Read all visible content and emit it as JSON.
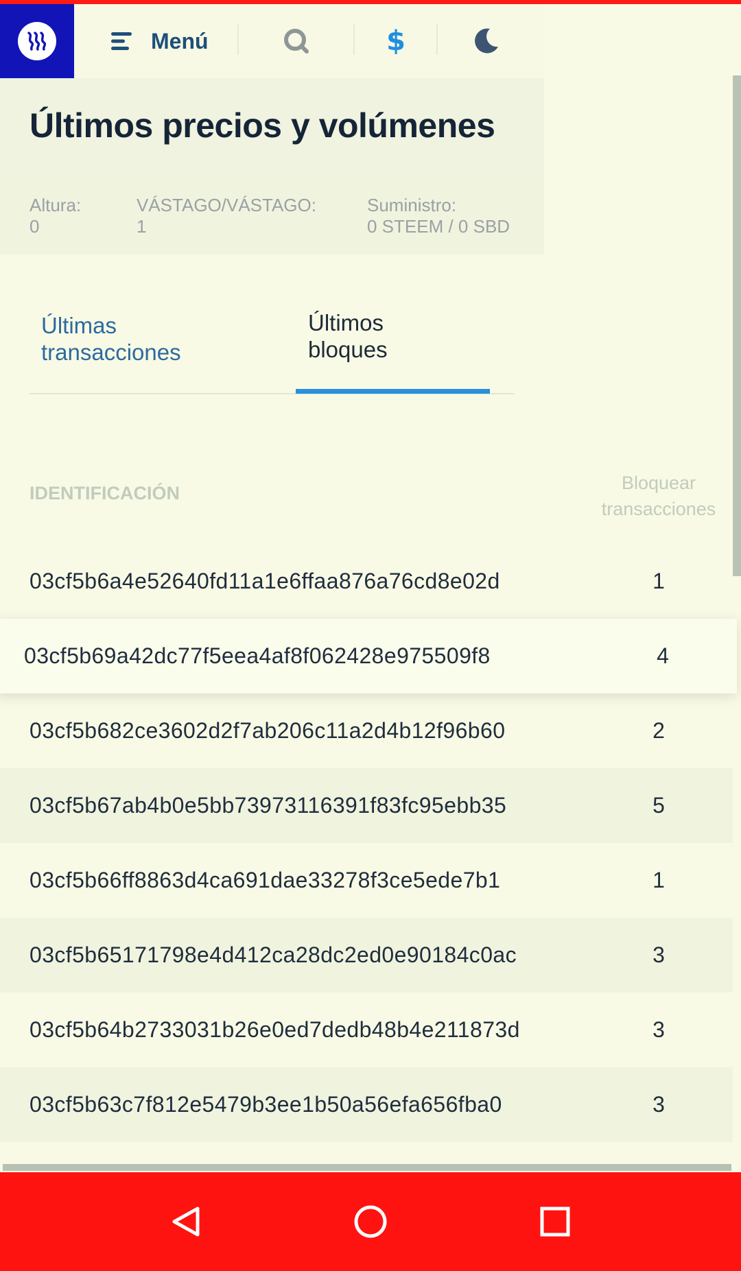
{
  "header": {
    "menu_label": "Menú",
    "logo_icon": "steem-logo-icon",
    "currency_symbol": "$",
    "colors": {
      "logo_bg": "#1214b8",
      "accent": "#2a8fdc",
      "menu_text": "#1d4f7a"
    }
  },
  "page_title": "Últimos precios y volúmenes",
  "stats": [
    {
      "label": "Altura:",
      "value": "0"
    },
    {
      "label": "VÁSTAGO/VÁSTAGO:",
      "value": "1"
    },
    {
      "label": "Suministro:",
      "value": "0 STEEM / 0 SBD"
    }
  ],
  "tabs": [
    {
      "line1": "Últimas",
      "line2": "transacciones",
      "active": false
    },
    {
      "line1": "Últimos",
      "line2": "bloques",
      "active": true
    }
  ],
  "table": {
    "col_id": "IDENTIFICACIÓN",
    "col_tx_line1": "Bloquear",
    "col_tx_line2": "transacciones",
    "rows": [
      {
        "id": "03cf5b6a4e52640fd11a1e6ffaa876a76cd8e02d",
        "tx": "1"
      },
      {
        "id": "03cf5b69a42dc77f5eea4af8f062428e975509f8",
        "tx": "4"
      },
      {
        "id": "03cf5b682ce3602d2f7ab206c11a2d4b12f96b60",
        "tx": "2"
      },
      {
        "id": "03cf5b67ab4b0e5bb73973116391f83fc95ebb35",
        "tx": "5"
      },
      {
        "id": "03cf5b66ff8863d4ca691dae33278f3ce5ede7b1",
        "tx": "1"
      },
      {
        "id": "03cf5b65171798e4d412ca28dc2ed0e90184c0ac",
        "tx": "3"
      },
      {
        "id": "03cf5b64b2733031b26e0ed7dedb48b4e211873d",
        "tx": "3"
      },
      {
        "id": "03cf5b63c7f812e5479b3ee1b50a56efa656fba0",
        "tx": "3"
      }
    ]
  },
  "navbar": {
    "back_icon": "back-triangle-icon",
    "home_icon": "home-circle-icon",
    "recents_icon": "recents-square-icon",
    "color": "#ff1311"
  }
}
